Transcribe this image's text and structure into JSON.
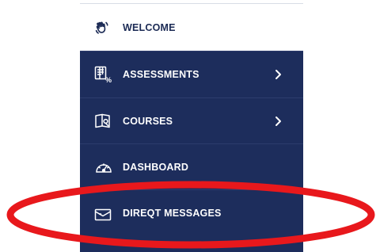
{
  "menu": {
    "items": [
      {
        "label": "WELCOME",
        "icon": "waving-hand-icon",
        "has_submenu": false
      },
      {
        "label": "ASSESSMENTS",
        "icon": "assessment-percent-icon",
        "has_submenu": true
      },
      {
        "label": "COURSES",
        "icon": "open-book-icon",
        "has_submenu": true
      },
      {
        "label": "DASHBOARD",
        "icon": "speedometer-icon",
        "has_submenu": false
      },
      {
        "label": "DIREQT MESSAGES",
        "icon": "envelope-icon",
        "has_submenu": false
      }
    ]
  },
  "colors": {
    "sidebar_bg": "#1d2d5c",
    "welcome_bg": "#ffffff",
    "highlight_ring": "#e8181c"
  }
}
